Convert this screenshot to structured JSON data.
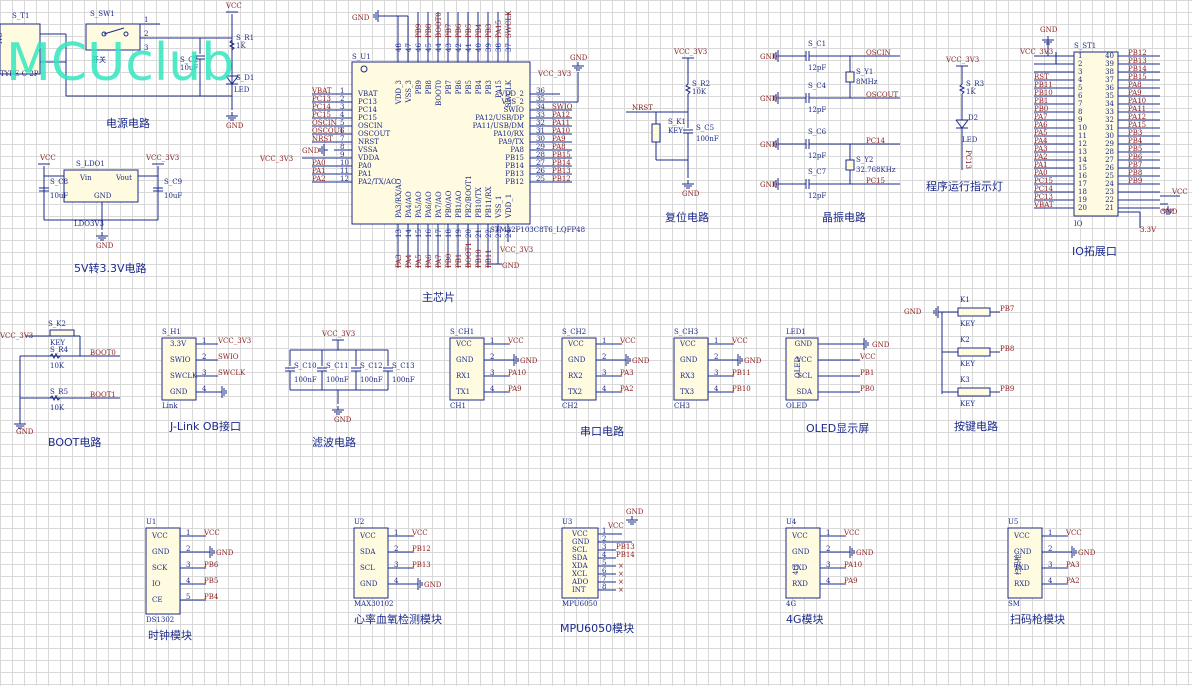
{
  "watermark": "MCUclub",
  "section_titles": {
    "power": "电源电路",
    "ldo": "5V转3.3V电路",
    "mcu": "主芯片",
    "reset": "复位电路",
    "crystal": "晶振电路",
    "run_led": "程序运行指示灯",
    "io": "IO拓展口",
    "boot": "BOOT电路",
    "jlink": "J-Link OB接口",
    "filter": "滤波电路",
    "uart": "串口电路",
    "oled": "OLED显示屏",
    "keys": "按键电路",
    "clock": "时钟模块",
    "heart": "心率血氧检测模块",
    "mpu": "MPU6050模块",
    "g4": "4G模块",
    "scanner": "扫码枪模块"
  },
  "mcu": {
    "ref": "S_U1",
    "part": "STM32F103C8T6_LQFP48",
    "left_pins": [
      {
        "num": "1",
        "name": "VBAT",
        "net": "VBAT"
      },
      {
        "num": "2",
        "name": "PC13",
        "net": "PC13"
      },
      {
        "num": "3",
        "name": "PC14",
        "net": "PC14"
      },
      {
        "num": "4",
        "name": "PC15",
        "net": "PC15"
      },
      {
        "num": "5",
        "name": "OSCIN",
        "net": "OSCIN"
      },
      {
        "num": "6",
        "name": "OSCOUT",
        "net": "OSCOUT"
      },
      {
        "num": "7",
        "name": "NRST",
        "net": "NRST"
      },
      {
        "num": "8",
        "name": "VSSA",
        "net": "GND"
      },
      {
        "num": "9",
        "name": "VDDA",
        "net": "VCC_3V3"
      },
      {
        "num": "10",
        "name": "PA0",
        "net": "PA0"
      },
      {
        "num": "11",
        "name": "PA1",
        "net": "PA1"
      },
      {
        "num": "12",
        "name": "PA2/TX/AO",
        "net": "PA2"
      }
    ],
    "right_pins": [
      {
        "num": "36",
        "name": "VDD_2",
        "net": "VCC_3V3"
      },
      {
        "num": "35",
        "name": "VSS_2",
        "net": ""
      },
      {
        "num": "34",
        "name": "SWIO",
        "net": "SWIO"
      },
      {
        "num": "33",
        "name": "PA12/USB/DP",
        "net": "PA12"
      },
      {
        "num": "32",
        "name": "PA11/USB/DM",
        "net": "PA11"
      },
      {
        "num": "31",
        "name": "PA10/RX",
        "net": "PA10"
      },
      {
        "num": "30",
        "name": "PA9/TX",
        "net": "PA9"
      },
      {
        "num": "29",
        "name": "PA8",
        "net": "PA8"
      },
      {
        "num": "28",
        "name": "PB15",
        "net": "PB15"
      },
      {
        "num": "27",
        "name": "PB14",
        "net": "PB14"
      },
      {
        "num": "26",
        "name": "PB13",
        "net": "PB13"
      },
      {
        "num": "25",
        "name": "PB12",
        "net": "PB12"
      }
    ],
    "top_pins": [
      "VDD_3",
      "VSS_3",
      "PB9",
      "PB8",
      "BOOT0",
      "PB7",
      "PB6",
      "PB5",
      "PB4",
      "PB3",
      "PA15",
      "SWCLK"
    ],
    "top_nums": [
      "48",
      "47",
      "46",
      "45",
      "44",
      "43",
      "42",
      "41",
      "40",
      "39",
      "38",
      "37"
    ],
    "top_nets": [
      "",
      "",
      "PB9",
      "PB8",
      "BOOT0",
      "PB7",
      "PB6",
      "PB5",
      "PB4",
      "PB3",
      "PA15",
      "SWCLK"
    ],
    "bottom_pins": [
      "PA3/RX/AO",
      "PA4/AO",
      "PA5/AO",
      "PA6/AO",
      "PA7/AO",
      "PB0/AO",
      "PB1/AO",
      "PB2/BOOT1",
      "PB10/TX",
      "PB11/RX",
      "VSS_1",
      "VDD_1"
    ],
    "bottom_nums": [
      "13",
      "14",
      "15",
      "16",
      "17",
      "18",
      "19",
      "20",
      "21",
      "22",
      "23",
      "24"
    ],
    "bottom_nets": [
      "PA3",
      "PA4",
      "PA5",
      "PA6",
      "PA7",
      "PB0",
      "PB1",
      "BOOT1",
      "PB10",
      "PB11",
      "",
      ""
    ],
    "vcc_label": "VCC_3V3",
    "gnd_label": "GND"
  },
  "power": {
    "ref": "S_T1",
    "sw": "S_SW1",
    "sw_label": "开关",
    "part": "TYPE-C-2P",
    "cap": "S_C2",
    "cap_val": "10uF",
    "res": "S_R1",
    "res_val": "1K",
    "led": "S_D1",
    "led_label": "LED",
    "vcc": "VCC",
    "gnd": "GND",
    "nc": "NC",
    "pins": [
      "1",
      "2",
      "3"
    ]
  },
  "ldo": {
    "ref": "S_LDO1",
    "part": "LDO3V3",
    "vin": "Vin",
    "vout": "Vout",
    "gnd_pin": "GND",
    "c_in": "S_C8",
    "c_in_val": "10uF",
    "c_out": "S_C9",
    "c_out_val": "10uF",
    "vcc_in": "VCC",
    "vcc_out": "VCC_3V3",
    "gnd": "GND"
  },
  "reset": {
    "vcc": "VCC_3V3",
    "res": "S_R2",
    "res_val": "10K",
    "key": "S_K1",
    "key_label": "KEY",
    "cap": "S_C5",
    "cap_val": "100nF",
    "net": "NRST",
    "gnd": "GND"
  },
  "crystal": {
    "c1": "S_C1",
    "c1_val": "12pF",
    "c4": "S_C4",
    "c4_val": "12pF",
    "y1": "S_Y1",
    "y1_val": "8MHz",
    "c6": "S_C6",
    "c6_val": "12pF",
    "c7": "S_C7",
    "c7_val": "12pF",
    "y2": "S_Y2",
    "y2_val": "32.768KHz",
    "nets": [
      "OSCIN",
      "OSCOUT",
      "PC14",
      "PC15"
    ],
    "gnd": "GND"
  },
  "run_led": {
    "vcc": "VCC_3V3",
    "res": "S_R3",
    "res_val": "1K",
    "led": "D2",
    "led_label": "LED",
    "net": "PC13"
  },
  "io": {
    "ref": "S_ST1",
    "part": "IO",
    "vcc": "VCC_3V3",
    "gnd": "GND",
    "vcc2": "VCC",
    "v33": "3.3V",
    "left_nets": [
      "",
      "",
      "RST",
      "PB11",
      "PB10",
      "PB1",
      "PB0",
      "PA7",
      "PA6",
      "PA5",
      "PA4",
      "PA3",
      "PA2",
      "PA1",
      "PA0",
      "PC15",
      "PC14",
      "PC13",
      "VBAT"
    ],
    "left_nums": [
      "1",
      "2",
      "3",
      "4",
      "5",
      "6",
      "7",
      "8",
      "9",
      "10",
      "11",
      "12",
      "13",
      "14",
      "15",
      "16",
      "17",
      "18",
      "19",
      "20"
    ],
    "right_nums": [
      "40",
      "39",
      "38",
      "37",
      "36",
      "35",
      "34",
      "33",
      "32",
      "31",
      "30",
      "29",
      "28",
      "27",
      "26",
      "25",
      "24",
      "23",
      "22",
      "21"
    ],
    "right_nets": [
      "PB12",
      "PB13",
      "PB14",
      "PB15",
      "PA8",
      "PA9",
      "PA10",
      "PA11",
      "PA12",
      "PA15",
      "PB3",
      "PB4",
      "PB5",
      "PB6",
      "PB7",
      "PB8",
      "PB9",
      "",
      "",
      ""
    ]
  },
  "boot": {
    "vcc": "VCC_3V3",
    "key": "S_K2",
    "key_label": "KEY",
    "r4": "S_R4",
    "r4_val": "10K",
    "r5": "S_R5",
    "r5_val": "10K",
    "net0": "BOOT0",
    "net1": "BOOT1",
    "gnd": "GND"
  },
  "jlink": {
    "ref": "S_H1",
    "part": "Link",
    "pins": [
      "3.3V",
      "SWIO",
      "SWCLK",
      "GND"
    ],
    "nums": [
      "1",
      "2",
      "3",
      "4"
    ],
    "nets": [
      "VCC_3V3",
      "SWIO",
      "SWCLK",
      ""
    ]
  },
  "filter": {
    "vcc": "VCC_3V3",
    "caps": [
      "S_C10",
      "S_C11",
      "S_C12",
      "S_C13"
    ],
    "vals": [
      "100nF",
      "100nF",
      "100nF",
      "100nF"
    ],
    "gnd": "GND"
  },
  "uart": [
    {
      "ref": "S_CH1",
      "part": "CH1",
      "pins": [
        "VCC",
        "GND",
        "RX1",
        "TX1"
      ],
      "nets": [
        "VCC",
        "GND",
        "PA10",
        "PA9"
      ]
    },
    {
      "ref": "S_CH2",
      "part": "CH2",
      "pins": [
        "VCC",
        "GND",
        "RX2",
        "TX2"
      ],
      "nets": [
        "VCC",
        "GND",
        "PA3",
        "PA2"
      ]
    },
    {
      "ref": "S_CH3",
      "part": "CH3",
      "pins": [
        "VCC",
        "GND",
        "RX3",
        "TX3"
      ],
      "nets": [
        "VCC",
        "GND",
        "PB11",
        "PB10"
      ]
    }
  ],
  "oled": {
    "ref": "LED1",
    "part": "OLED",
    "body": "OLED",
    "pins": [
      "GND",
      "VCC",
      "SCL",
      "SDA"
    ],
    "nets": [
      "GND",
      "VCC",
      "PB1",
      "PB0"
    ]
  },
  "keys": {
    "gnd": "GND",
    "items": [
      {
        "ref": "K1",
        "label": "KEY",
        "net": "PB7"
      },
      {
        "ref": "K2",
        "label": "KEY",
        "net": "PB8"
      },
      {
        "ref": "K3",
        "label": "KEY",
        "net": "PB9"
      }
    ]
  },
  "modules": [
    {
      "ref": "U1",
      "part": "DS1302",
      "pins": [
        "VCC",
        "GND",
        "SCK",
        "IO",
        "CE"
      ],
      "nets": [
        "VCC",
        "GND",
        "PB6",
        "PB5",
        "PB4"
      ],
      "body": ""
    },
    {
      "ref": "U2",
      "part": "MAX30102",
      "pins": [
        "VCC",
        "SDA",
        "SCL",
        "GND"
      ],
      "nets": [
        "VCC",
        "PB12",
        "PB13",
        "GND"
      ],
      "body": ""
    },
    {
      "ref": "U4",
      "part": "4G",
      "pins": [
        "VCC",
        "GND",
        "TXD",
        "RXD"
      ],
      "nets": [
        "VCC",
        "GND",
        "PA10",
        "PA9"
      ],
      "body": "4G"
    },
    {
      "ref": "U5",
      "part": "SM",
      "pins": [
        "VCC",
        "GND",
        "TXD",
        "RXD"
      ],
      "nets": [
        "VCC",
        "GND",
        "PA3",
        "PA2"
      ],
      "body": "扫码枪"
    }
  ],
  "mpu": {
    "ref": "U3",
    "part": "MPU6050",
    "pins": [
      "VCC",
      "GND",
      "SCL",
      "SDA",
      "XDA",
      "XCL",
      "ADO",
      "INT"
    ],
    "nets": [
      "VCC",
      "GND",
      "PB13",
      "PB14",
      "",
      "",
      "",
      ""
    ]
  }
}
